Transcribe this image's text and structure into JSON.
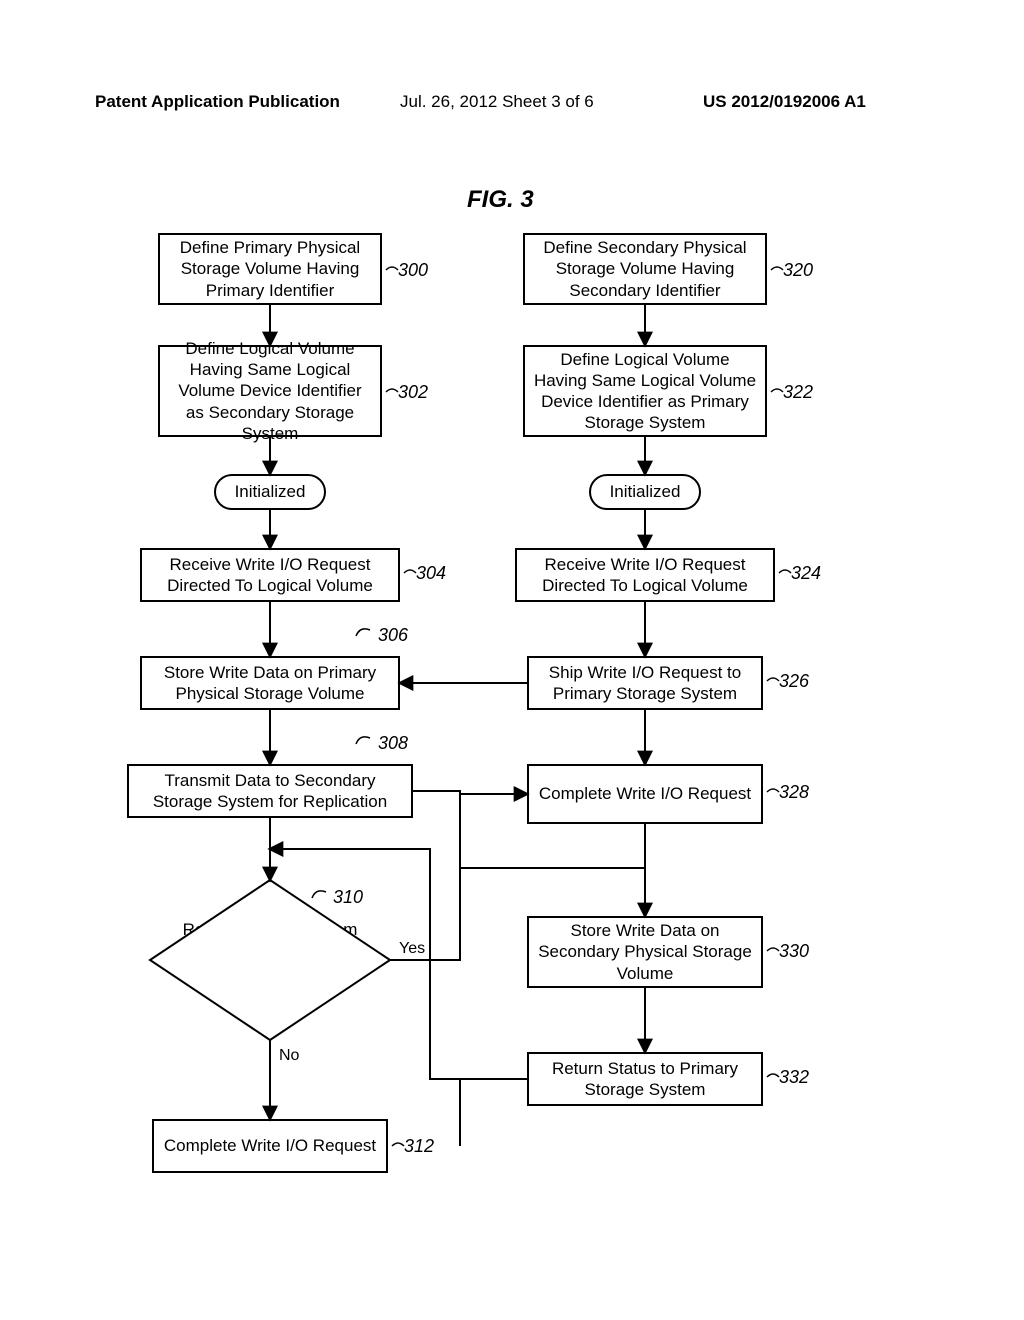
{
  "header": {
    "left": "Patent Application Publication",
    "center": "Jul. 26, 2012  Sheet 3 of 6",
    "right": "US 2012/0192006 A1"
  },
  "figure_title": "FIG. 3",
  "left": {
    "b300": "Define Primary Physical Storage Volume Having Primary Identifier",
    "b302": "Define Logical Volume Having Same Logical Volume Device Identifier as Secondary Storage System",
    "init": "Initialized",
    "b304": "Receive Write I/O Request Directed To Logical Volume",
    "b306": "Store Write Data on Primary Physical Storage Volume",
    "b308": "Transmit Data to Secondary Storage System for Replication",
    "b310": "Request Shipped From Secondary Storage System?",
    "b312": "Complete Write I/O Request"
  },
  "right": {
    "b320": "Define Secondary Physical Storage Volume Having Secondary Identifier",
    "b322": "Define Logical Volume Having Same Logical Volume Device Identifier as Primary Storage System",
    "init": "Initialized",
    "b324": "Receive Write I/O Request Directed To Logical Volume",
    "b326": "Ship Write I/O Request to Primary Storage System",
    "b328": "Complete Write I/O Request",
    "b330": "Store Write Data on Secondary Physical Storage Volume",
    "b332": "Return Status to Primary Storage System"
  },
  "refs": {
    "r300": "300",
    "r302": "302",
    "r304": "304",
    "r306": "306",
    "r308": "308",
    "r310": "310",
    "r312": "312",
    "r320": "320",
    "r322": "322",
    "r324": "324",
    "r326": "326",
    "r328": "328",
    "r330": "330",
    "r332": "332"
  },
  "labels": {
    "yes": "Yes",
    "no": "No"
  },
  "chart_data": {
    "type": "flowchart",
    "columns": [
      "primary",
      "secondary"
    ],
    "nodes": [
      {
        "id": "300",
        "col": "primary",
        "shape": "process",
        "text": "Define Primary Physical Storage Volume Having Primary Identifier"
      },
      {
        "id": "302",
        "col": "primary",
        "shape": "process",
        "text": "Define Logical Volume Having Same Logical Volume Device Identifier as Secondary Storage System"
      },
      {
        "id": "initL",
        "col": "primary",
        "shape": "terminator",
        "text": "Initialized"
      },
      {
        "id": "304",
        "col": "primary",
        "shape": "process",
        "text": "Receive Write I/O Request Directed To Logical Volume"
      },
      {
        "id": "306",
        "col": "primary",
        "shape": "process",
        "text": "Store Write Data on Primary Physical Storage Volume"
      },
      {
        "id": "308",
        "col": "primary",
        "shape": "process",
        "text": "Transmit Data to Secondary Storage System for Replication"
      },
      {
        "id": "310",
        "col": "primary",
        "shape": "decision",
        "text": "Request Shipped From Secondary Storage System?"
      },
      {
        "id": "312",
        "col": "primary",
        "shape": "process",
        "text": "Complete Write I/O Request"
      },
      {
        "id": "320",
        "col": "secondary",
        "shape": "process",
        "text": "Define Secondary Physical Storage Volume Having Secondary Identifier"
      },
      {
        "id": "322",
        "col": "secondary",
        "shape": "process",
        "text": "Define Logical Volume Having Same Logical Volume Device Identifier as Primary Storage System"
      },
      {
        "id": "initR",
        "col": "secondary",
        "shape": "terminator",
        "text": "Initialized"
      },
      {
        "id": "324",
        "col": "secondary",
        "shape": "process",
        "text": "Receive Write I/O Request Directed To Logical Volume"
      },
      {
        "id": "326",
        "col": "secondary",
        "shape": "process",
        "text": "Ship Write I/O Request to Primary Storage System"
      },
      {
        "id": "328",
        "col": "secondary",
        "shape": "process",
        "text": "Complete Write I/O Request"
      },
      {
        "id": "330",
        "col": "secondary",
        "shape": "process",
        "text": "Store Write Data on Secondary Physical Storage Volume"
      },
      {
        "id": "332",
        "col": "secondary",
        "shape": "process",
        "text": "Return Status to Primary Storage System"
      }
    ],
    "edges": [
      {
        "from": "300",
        "to": "302"
      },
      {
        "from": "302",
        "to": "initL"
      },
      {
        "from": "initL",
        "to": "304"
      },
      {
        "from": "304",
        "to": "306"
      },
      {
        "from": "306",
        "to": "308"
      },
      {
        "from": "308",
        "to": "310"
      },
      {
        "from": "310",
        "to": "312",
        "label": "No"
      },
      {
        "from": "310",
        "to": "328",
        "label": "Yes"
      },
      {
        "from": "320",
        "to": "322"
      },
      {
        "from": "322",
        "to": "initR"
      },
      {
        "from": "initR",
        "to": "324"
      },
      {
        "from": "324",
        "to": "326"
      },
      {
        "from": "326",
        "to": "306"
      },
      {
        "from": "326",
        "to": "328"
      },
      {
        "from": "328",
        "to": "330"
      },
      {
        "from": "330",
        "to": "332"
      },
      {
        "from": "332",
        "to": "310"
      },
      {
        "from": "308",
        "to": "330"
      }
    ]
  }
}
